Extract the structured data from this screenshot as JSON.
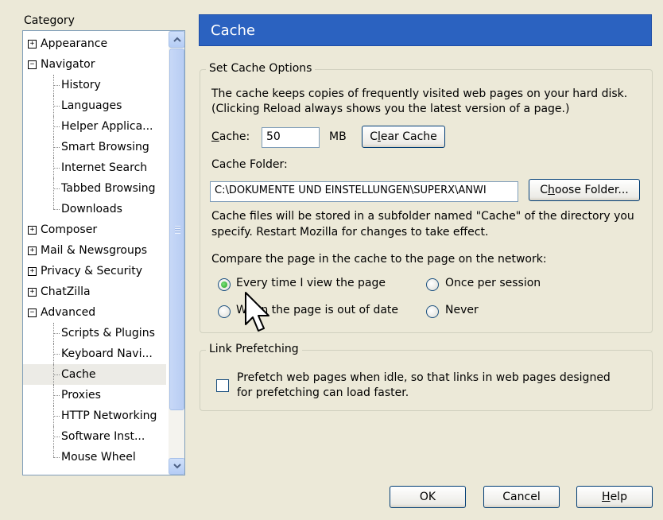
{
  "category": {
    "label": "Category",
    "items": [
      {
        "label": "Appearance",
        "level": 0,
        "expander": "+"
      },
      {
        "label": "Navigator",
        "level": 0,
        "expander": "−"
      },
      {
        "label": "History",
        "level": 1
      },
      {
        "label": "Languages",
        "level": 1
      },
      {
        "label": "Helper Applica...",
        "level": 1
      },
      {
        "label": "Smart Browsing",
        "level": 1
      },
      {
        "label": "Internet Search",
        "level": 1
      },
      {
        "label": "Tabbed Browsing",
        "level": 1
      },
      {
        "label": "Downloads",
        "level": 1
      },
      {
        "label": "Composer",
        "level": 0,
        "expander": "+"
      },
      {
        "label": "Mail & Newsgroups",
        "level": 0,
        "expander": "+"
      },
      {
        "label": "Privacy & Security",
        "level": 0,
        "expander": "+"
      },
      {
        "label": "ChatZilla",
        "level": 0,
        "expander": "+"
      },
      {
        "label": "Advanced",
        "level": 0,
        "expander": "−"
      },
      {
        "label": "Scripts & Plugins",
        "level": 1
      },
      {
        "label": "Keyboard Navi...",
        "level": 1
      },
      {
        "label": "Cache",
        "level": 1,
        "selected": true
      },
      {
        "label": "Proxies",
        "level": 1
      },
      {
        "label": "HTTP Networking",
        "level": 1
      },
      {
        "label": "Software Inst...",
        "level": 1
      },
      {
        "label": "Mouse Wheel",
        "level": 1
      }
    ]
  },
  "header": {
    "title": "Cache"
  },
  "cache_options": {
    "legend": "Set Cache Options",
    "description_line1": "The cache keeps copies of frequently visited web pages on your hard disk.",
    "description_line2": "(Clicking Reload always shows you the latest version of a page.)",
    "cache_label_key": "C",
    "cache_label_rest": "ache:",
    "cache_value": "50",
    "cache_unit": "MB",
    "clear_cache_pre": "C",
    "clear_cache_key": "l",
    "clear_cache_post": "ear Cache",
    "folder_label": "Cache Folder:",
    "folder_path": "C:\\DOKUMENTE UND EINSTELLUNGEN\\SUPERX\\ANWI",
    "choose_folder_pre": "C",
    "choose_folder_key": "h",
    "choose_folder_post": "oose Folder...",
    "folder_note_line1": "Cache files will be stored in a subfolder named \"Cache\" of the directory you",
    "folder_note_line2": "specify. Restart Mozilla for changes to take effect.",
    "compare_label": "Compare the page in the cache to the page on the network:",
    "options": {
      "every_time": "Every time I view the page",
      "once_per_session": "Once per session",
      "out_of_date": "When the page is out of date",
      "never": "Never"
    },
    "selected_option": "every_time"
  },
  "prefetch": {
    "legend": "Link Prefetching",
    "checkbox_line1": "Prefetch web pages when idle, so that links in web pages designed",
    "checkbox_line2": "for prefetching can load faster.",
    "checked": false
  },
  "buttons": {
    "ok": "OK",
    "cancel": "Cancel",
    "help_key": "H",
    "help_rest": "elp"
  },
  "colors": {
    "header_bg": "#2b62c0",
    "window_bg": "#ece9d8"
  },
  "icons": [
    "scroll-up-arrow-icon",
    "scroll-down-arrow-icon",
    "mouse-pointer-icon"
  ]
}
